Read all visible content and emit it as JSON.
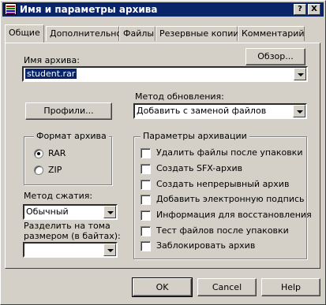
{
  "window": {
    "title": "Имя и параметры архива"
  },
  "titlebar_buttons": {
    "help": "?",
    "close": "X"
  },
  "tabs": [
    {
      "label": "Общие"
    },
    {
      "label": "Дополнительно"
    },
    {
      "label": "Файлы"
    },
    {
      "label": "Резервные копии"
    },
    {
      "label": "Комментарий"
    }
  ],
  "archive_name": {
    "label": "Имя архива:",
    "value": "student.rar",
    "browse_label": "Обзор..."
  },
  "update_method": {
    "label": "Метод обновления:",
    "value": "Добавить с заменой файлов"
  },
  "profiles_label": "Профили...",
  "format": {
    "title": "Формат архива",
    "options": [
      {
        "label": "RAR",
        "selected": true
      },
      {
        "label": "ZIP",
        "selected": false
      }
    ]
  },
  "compression": {
    "label": "Метод сжатия:",
    "value": "Обычный"
  },
  "split": {
    "label_line1": "Разделить на тома",
    "label_line2": "размером (в байтах):",
    "value": ""
  },
  "options": {
    "title": "Параметры архивации",
    "items": [
      {
        "label": "Удалить файлы после упаковки",
        "checked": false
      },
      {
        "label": "Создать SFX-архив",
        "checked": false
      },
      {
        "label": "Создать непрерывный архив",
        "checked": false
      },
      {
        "label": "Добавить электронную подпись",
        "checked": false
      },
      {
        "label": "Информация для восстановления",
        "checked": false
      },
      {
        "label": "Тест файлов после упаковки",
        "checked": false
      },
      {
        "label": "Заблокировать архив",
        "checked": false
      }
    ]
  },
  "buttons": {
    "ok": "OK",
    "cancel": "Cancel",
    "help": "Help"
  }
}
